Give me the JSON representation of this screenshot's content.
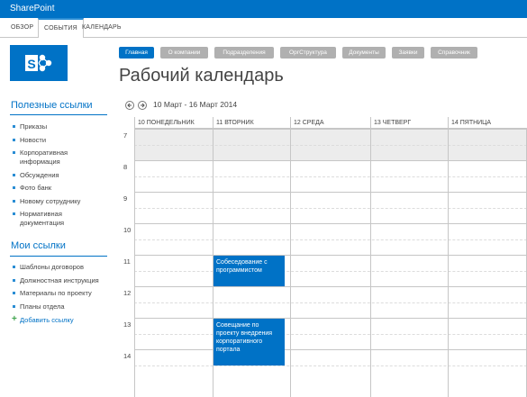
{
  "suite": {
    "brand": "SharePoint"
  },
  "ribbon": {
    "tabs": [
      "ОБЗОР",
      "СОБЫТИЯ",
      "КАЛЕНДАРЬ"
    ]
  },
  "topnav": [
    "Главная",
    "О компании",
    "Подразделения",
    "ОргСтруктура",
    "Документы",
    "Заявки",
    "Справочник"
  ],
  "page": {
    "title": "Рабочий календарь"
  },
  "sidebar": {
    "useful_heading": "Полезные ссылки",
    "useful_links": [
      "Приказы",
      "Новости",
      "Корпоративная информация",
      "Обсуждения",
      "Фото банк",
      "Новому сотруднику",
      "Нормативная документация"
    ],
    "my_heading": "Мои ссылки",
    "my_links": [
      "Шаблоны договоров",
      "Должностная инструкция",
      "Материалы по проекту",
      "Планы отдела"
    ],
    "add_link": "Добавить ссылку"
  },
  "calendar": {
    "date_range": "10 Март - 16 Март 2014",
    "days": [
      "10 ПОНЕДЕЛЬНИК",
      "11 ВТОРНИК",
      "12 СРЕДА",
      "13 ЧЕТВЕРГ",
      "14 ПЯТНИЦА"
    ],
    "hours": [
      "7",
      "8",
      "9",
      "10",
      "11",
      "12",
      "13",
      "14"
    ],
    "events": [
      {
        "title": "Собеседование с программистом"
      },
      {
        "title": "Совещание по проекту внедрения корпоративного портала"
      }
    ]
  },
  "colors": {
    "brand": "#0072c6",
    "nav_inactive": "#b0b0b0",
    "add_plus": "#3fa34d"
  }
}
